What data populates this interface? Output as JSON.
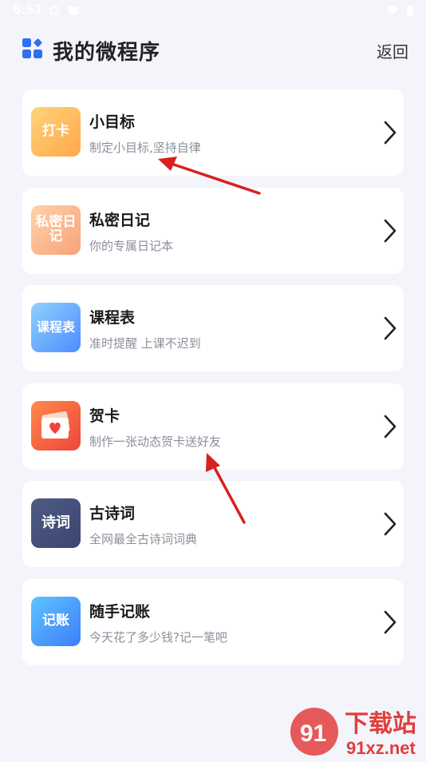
{
  "status_bar": {
    "time": "8:51"
  },
  "header": {
    "title": "我的微程序",
    "back_label": "返回"
  },
  "apps": [
    {
      "title": "小目标",
      "subtitle": "制定小目标,坚持自律",
      "thumb_text": "打卡",
      "icon": "clock-in-icon"
    },
    {
      "title": "私密日记",
      "subtitle": "你的专属日记本",
      "thumb_text": "私密日记",
      "icon": "diary-icon"
    },
    {
      "title": "课程表",
      "subtitle": "准时提醒 上课不迟到",
      "thumb_text": "课程表",
      "icon": "schedule-icon"
    },
    {
      "title": "贺卡",
      "subtitle": "制作一张动态贺卡送好友",
      "thumb_text": "",
      "icon": "greeting-card-icon"
    },
    {
      "title": "古诗词",
      "subtitle": "全网最全古诗词词典",
      "thumb_text": "诗词",
      "icon": "poetry-icon"
    },
    {
      "title": "随手记账",
      "subtitle": "今天花了多少钱?记一笔吧",
      "thumb_text": "记账",
      "icon": "bookkeeping-icon"
    }
  ],
  "watermark": {
    "brand": "下载站",
    "domain": "91xz.net"
  }
}
